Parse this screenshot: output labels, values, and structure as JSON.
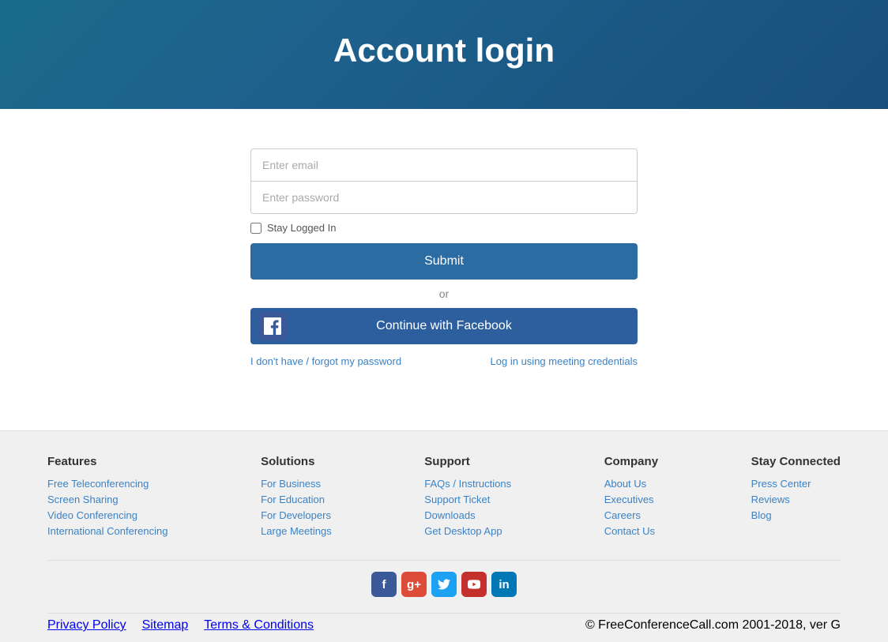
{
  "header": {
    "title": "Account login"
  },
  "form": {
    "email_placeholder": "Enter email",
    "password_placeholder": "Enter password",
    "stay_logged_label": "Stay Logged In",
    "submit_label": "Submit",
    "or_text": "or",
    "facebook_btn_label": "Continue with Facebook",
    "forgot_link": "I don't have / forgot my password",
    "meeting_link": "Log in using meeting credentials"
  },
  "footer": {
    "columns": [
      {
        "heading": "Features",
        "links": [
          "Free Teleconferencing",
          "Screen Sharing",
          "Video Conferencing",
          "International Conferencing"
        ]
      },
      {
        "heading": "Solutions",
        "links": [
          "For Business",
          "For Education",
          "For Developers",
          "Large Meetings"
        ]
      },
      {
        "heading": "Support",
        "links": [
          "FAQs / Instructions",
          "Support Ticket",
          "Downloads",
          "Get Desktop App"
        ]
      },
      {
        "heading": "Company",
        "links": [
          "About Us",
          "Executives",
          "Careers",
          "Contact Us"
        ]
      },
      {
        "heading": "Stay Connected",
        "links": [
          "Press Center",
          "Reviews",
          "Blog"
        ]
      }
    ],
    "bottom_links": [
      "Privacy Policy",
      "Sitemap",
      "Terms & Conditions"
    ],
    "copyright": "© FreeConferenceCall.com 2001-2018, ver G"
  }
}
